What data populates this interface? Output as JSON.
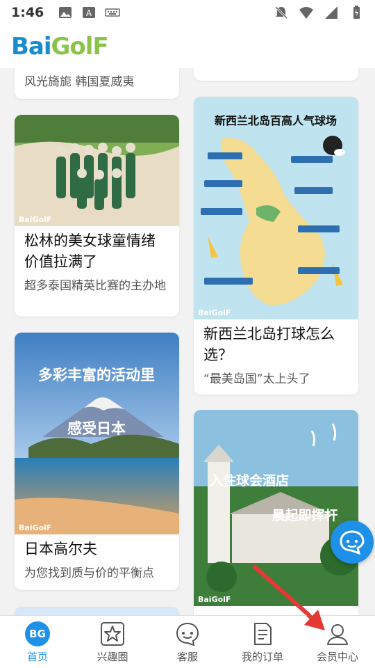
{
  "status_bar": {
    "time": "1:46"
  },
  "header": {
    "logo_part1": "Bai",
    "logo_part2": "GolF"
  },
  "cards": [
    {
      "subtitle": "风光旖旎 韩国夏威夷"
    },
    {
      "title": "松林的美女球童情绪价值拉满了",
      "subtitle": "超多泰国精英比赛的主办地",
      "watermark": "BaiGolF"
    },
    {
      "image_text_1": "多彩丰富的活动里",
      "image_text_2": "感受日本",
      "title": "日本高尔夫",
      "subtitle": "为您找到质与价的平衡点",
      "watermark": "BaiGolF"
    },
    {
      "image_text": "新西兰北岛百高人气球场",
      "title": "新西兰北岛打球怎么选？",
      "subtitle": "“最美岛国”太上头了",
      "watermark": "BaiGolF"
    },
    {
      "image_text_1": "入住球会酒店",
      "image_text_2": "晨起即挥杆",
      "watermark": "BaiGolF"
    }
  ],
  "bottom_nav": {
    "items": [
      {
        "label": "首页",
        "badge": "BG",
        "icon": "home-icon",
        "active": true
      },
      {
        "label": "兴趣圈",
        "icon": "star-icon",
        "active": false
      },
      {
        "label": "客服",
        "icon": "chat-icon",
        "active": false
      },
      {
        "label": "我的订单",
        "icon": "document-icon",
        "active": false
      },
      {
        "label": "会员中心",
        "icon": "user-icon",
        "active": false
      }
    ]
  },
  "colors": {
    "accent": "#1e90e8",
    "logo_blue": "#1a8ccc",
    "logo_green": "#8bc34a",
    "arrow_red": "#e53935"
  }
}
